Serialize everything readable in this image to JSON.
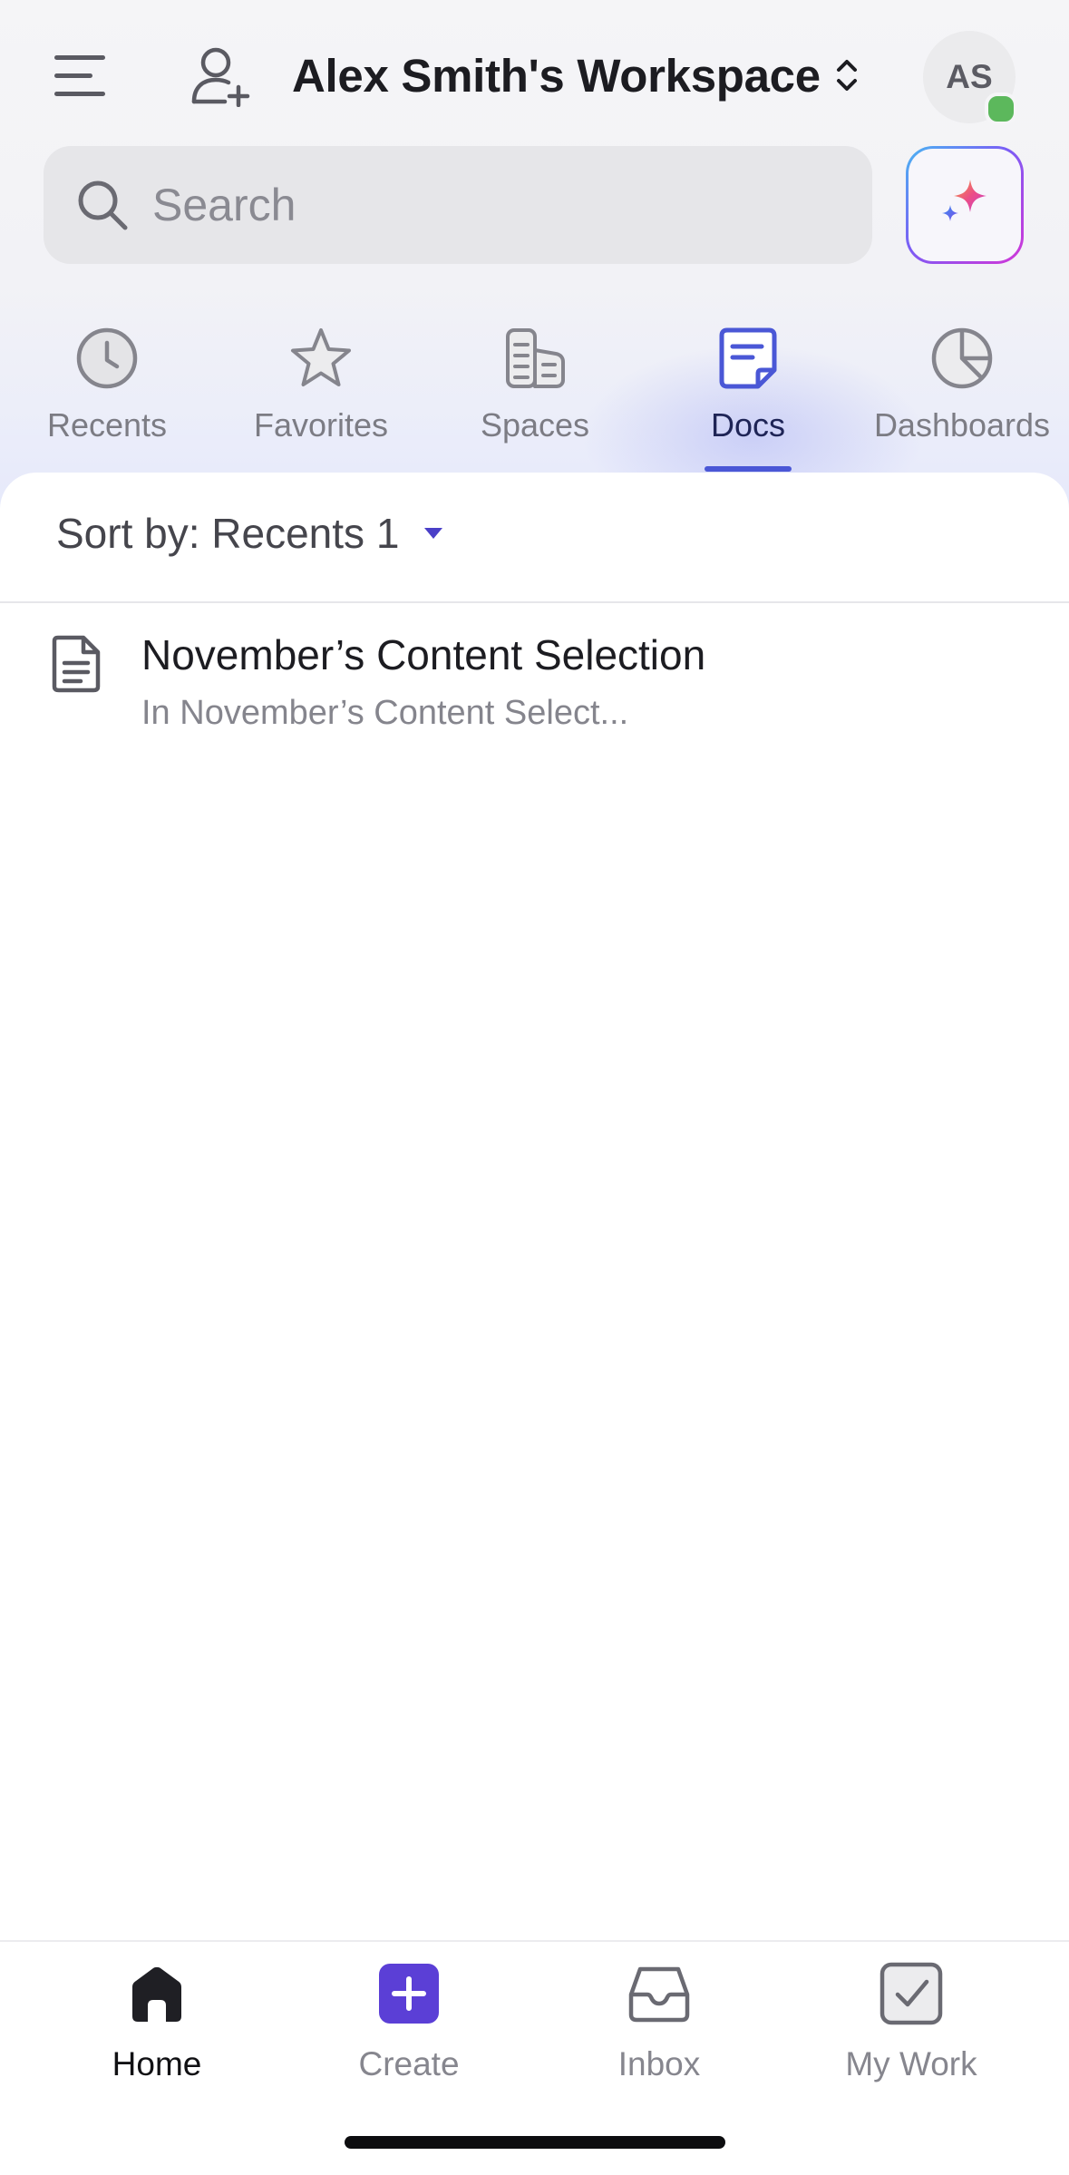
{
  "header": {
    "menu_icon": "hamburger-menu-icon",
    "add_user_icon": "add-user-icon",
    "workspace_title": "Alex Smith's Workspace",
    "switcher_icon": "chevron-up-down-icon",
    "avatar_initials": "AS",
    "presence_color": "#5cb85c"
  },
  "search": {
    "placeholder": "Search",
    "value": "",
    "ai_button_icon": "ai-sparkle-icon"
  },
  "tabs": [
    {
      "label": "Recents",
      "icon": "clock-icon",
      "active": false
    },
    {
      "label": "Favorites",
      "icon": "star-icon",
      "active": false
    },
    {
      "label": "Spaces",
      "icon": "spaces-icon",
      "active": false
    },
    {
      "label": "Docs",
      "icon": "doc-icon",
      "active": true
    },
    {
      "label": "Dashboards",
      "icon": "pie-chart-icon",
      "active": false
    }
  ],
  "sort": {
    "label": "Sort by: Recents 1",
    "caret_icon": "caret-down-icon"
  },
  "docs": [
    {
      "title": "November’s Content Selection",
      "subtitle": "In November’s Content Select...",
      "icon": "document-icon"
    }
  ],
  "bottom_nav": [
    {
      "label": "Home",
      "icon": "home-icon",
      "active": true
    },
    {
      "label": "Create",
      "icon": "plus-square-icon",
      "active": false
    },
    {
      "label": "Inbox",
      "icon": "inbox-icon",
      "active": false
    },
    {
      "label": "My Work",
      "icon": "checkbox-icon",
      "active": false
    }
  ],
  "colors": {
    "accent": "#4a57d6",
    "create_button": "#5b3fd6",
    "text_primary": "#1c1c21",
    "text_muted": "#7c7c84"
  }
}
